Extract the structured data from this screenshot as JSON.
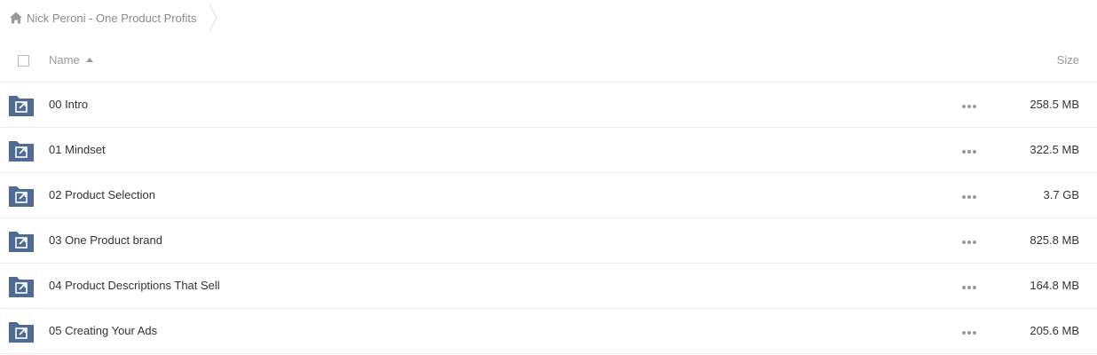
{
  "breadcrumb": {
    "home_icon": "home-icon",
    "current_folder": "Nick Peroni - One Product Profits"
  },
  "header": {
    "name_label": "Name",
    "size_label": "Size",
    "sort": "ascending"
  },
  "rows": [
    {
      "name": "00 Intro",
      "size": "258.5 MB",
      "icon": "shared-folder-icon"
    },
    {
      "name": "01 Mindset",
      "size": "322.5 MB",
      "icon": "shared-folder-icon"
    },
    {
      "name": "02 Product Selection",
      "size": "3.7 GB",
      "icon": "shared-folder-icon"
    },
    {
      "name": "03 One Product brand",
      "size": "825.8 MB",
      "icon": "shared-folder-icon"
    },
    {
      "name": "04 Product Descriptions That Sell",
      "size": "164.8 MB",
      "icon": "shared-folder-icon"
    },
    {
      "name": "05 Creating Your Ads",
      "size": "205.6 MB",
      "icon": "shared-folder-icon"
    }
  ],
  "colors": {
    "folder": "#4f6b91",
    "muted_text": "#8a8a8a",
    "text": "#333333",
    "divider": "#ececec"
  }
}
